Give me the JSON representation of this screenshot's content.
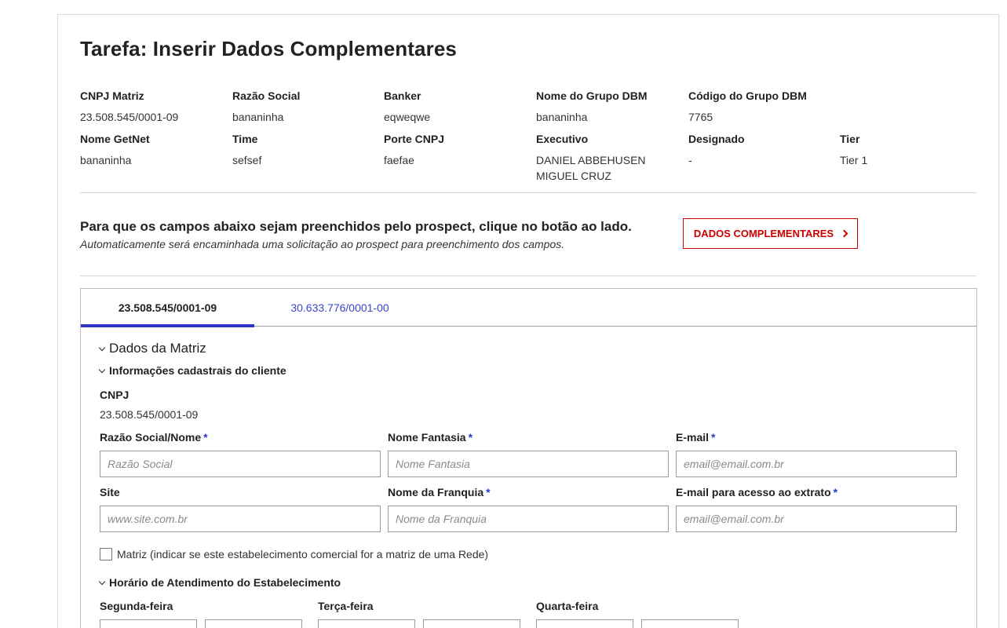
{
  "page_title": "Tarefa: Inserir Dados Complementares",
  "info": [
    {
      "label": "CNPJ Matriz",
      "value": [
        "23.508.545/0001-09"
      ]
    },
    {
      "label": "Razão Social",
      "value": [
        "bananinha"
      ]
    },
    {
      "label": "Banker",
      "value": [
        "eqweqwe"
      ]
    },
    {
      "label": "Nome do Grupo DBM",
      "value": [
        "bananinha"
      ]
    },
    {
      "label": "Código do Grupo DBM",
      "value": [
        "7765"
      ]
    },
    {
      "label": "Nome GetNet",
      "value": [
        "bananinha"
      ]
    },
    {
      "label": "Time",
      "value": [
        "sefsef"
      ]
    },
    {
      "label": "Porte CNPJ",
      "value": [
        "faefae"
      ]
    },
    {
      "label": "Executivo",
      "value": [
        "DANIEL ABBEHUSEN",
        "MIGUEL CRUZ"
      ]
    },
    {
      "label": "Designado",
      "value": [
        "-"
      ]
    },
    {
      "label": "Tier",
      "value": [
        "Tier 1"
      ]
    }
  ],
  "cta": {
    "title": "Para que os campos abaixo sejam preenchidos pelo prospect, clique no botão ao lado.",
    "subtitle": "Automaticamente será encaminhada uma solicitação ao prospect para preenchimento dos campos.",
    "button_label": "DADOS COMPLEMENTARES"
  },
  "tabs": [
    {
      "label": "23.508.545/0001-09",
      "active": true
    },
    {
      "label": "30.633.776/0001-00",
      "active": false
    }
  ],
  "sections": {
    "matriz": "Dados da Matriz",
    "cadastrais": "Informações cadastrais do cliente",
    "horario": "Horário de Atendimento do Estabelecimento"
  },
  "cnpj": {
    "label": "CNPJ",
    "value": "23.508.545/0001-09"
  },
  "fields": [
    {
      "label": "Razão Social/Nome",
      "required": "*",
      "placeholder": "Razão Social",
      "value": ""
    },
    {
      "label": "Nome Fantasia",
      "required": "*",
      "placeholder": "Nome Fantasia",
      "value": ""
    },
    {
      "label": "E-mail",
      "required": "*",
      "placeholder": "email@email.com.br",
      "value": ""
    },
    {
      "label": "Site",
      "required": "",
      "placeholder": "www.site.com.br",
      "value": ""
    },
    {
      "label": "Nome da Franquia",
      "required": "*",
      "placeholder": "Nome da Franquia",
      "value": ""
    },
    {
      "label": "E-mail para acesso ao extrato",
      "required": "*",
      "placeholder": "email@email.com.br",
      "value": ""
    }
  ],
  "matriz_checkbox": {
    "label": "Matriz (indicar se este estabelecimento comercial for a matriz de uma Rede)",
    "checked": false
  },
  "days": [
    "Segunda-feira",
    "Terça-feira",
    "Quarta-feira"
  ],
  "colors": {
    "accent_red": "#cc0000",
    "tab_accent": "#2b36c6",
    "required_marker": "#2b36c6"
  },
  "icons": {
    "cta_button": "chevron-right-icon",
    "section_toggle": "chevron-down-icon"
  }
}
